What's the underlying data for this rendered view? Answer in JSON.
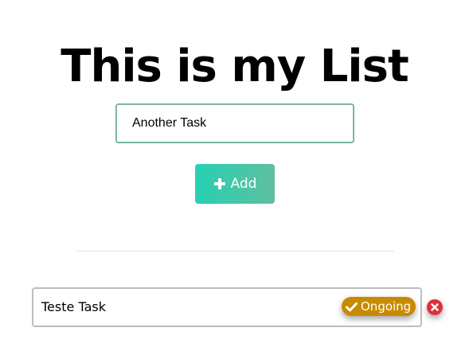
{
  "header": {
    "title": "This is my List"
  },
  "form": {
    "task_input_value": "Another Task",
    "add_button_label": "Add",
    "add_icon": "plus-icon"
  },
  "tasks": [
    {
      "text": "Teste Task",
      "status_label": "Ongoing",
      "status_icon": "check-icon",
      "delete_icon": "close-icon"
    }
  ],
  "colors": {
    "accent_start": "#27d0b2",
    "accent_end": "#5fbfa0",
    "status_ongoing": "#c88a00",
    "delete": "#e0303a"
  }
}
